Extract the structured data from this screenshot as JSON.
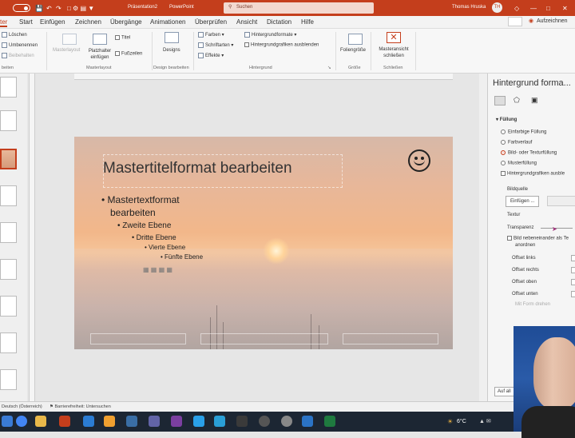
{
  "titlebar": {
    "file": "Präsentation2",
    "app": "PowerPoint",
    "user": "Thomas Hruska",
    "search_placeholder": "Suchen",
    "record_button": "Aufzeichnen"
  },
  "tabs": [
    "ter",
    "Start",
    "Einfügen",
    "Zeichnen",
    "Übergänge",
    "Animationen",
    "Überprüfen",
    "Ansicht",
    "Dictation",
    "Hilfe"
  ],
  "ribbon": {
    "delete": "Löschen",
    "rename": "Umbenennen",
    "preserve": "Beibehalten",
    "master_layout": "Masterlayout",
    "placeholder": "Platzhalter einfügen",
    "title_cb": "Titel",
    "footer_cb": "Fußzeilen",
    "designs": "Designs",
    "colors": "Farben",
    "fonts": "Schriftarten",
    "effects": "Effekte",
    "bg_formats": "Hintergrundformate",
    "hide_bg": "Hintergrundgrafiken ausblenden",
    "slide_size": "Foliengröße",
    "close_master": "Masteransicht schließen",
    "groups": {
      "beiten": "beiten",
      "masterlayout": "Masterlayout",
      "design": "Design bearbeiten",
      "hintergrund": "Hintergrund",
      "groesse": "Größe",
      "schliessen": "Schließen"
    }
  },
  "slide": {
    "title": "Mastertitelformat bearbeiten",
    "l1a": "Mastertextformat",
    "l1b": "bearbeiten",
    "l2": "Zweite Ebene",
    "l3": "Dritte Ebene",
    "l4": "Vierte Ebene",
    "l5": "Fünfte Ebene"
  },
  "pane": {
    "title": "Hintergrund forma...",
    "section": "Füllung",
    "options": [
      "Einfarbige Füllung",
      "Farbverlauf",
      "Bild- oder Texturfüllung",
      "Musterfüllung",
      "Hintergrundgrafiken ausble"
    ],
    "image_source": "Bildquelle",
    "insert": "Einfügen ...",
    "texture": "Textur",
    "transparency": "Transparenz",
    "tile": "Bild nebeneinander als Te",
    "tile2": "anordnen",
    "offsets": [
      "Offset links",
      "Offset rechts",
      "Offset oben",
      "Offset unten"
    ],
    "rotate": "Mit Form drehen",
    "apply": "Auf all"
  },
  "status": {
    "view": "Folienmaster",
    "lang": "Deutsch (Österreich)",
    "accessibility": "Barrierefreiheit: Untersuchen"
  },
  "taskbar": {
    "temp": "6°C"
  },
  "colors": {
    "accent": "#c43e1c"
  }
}
